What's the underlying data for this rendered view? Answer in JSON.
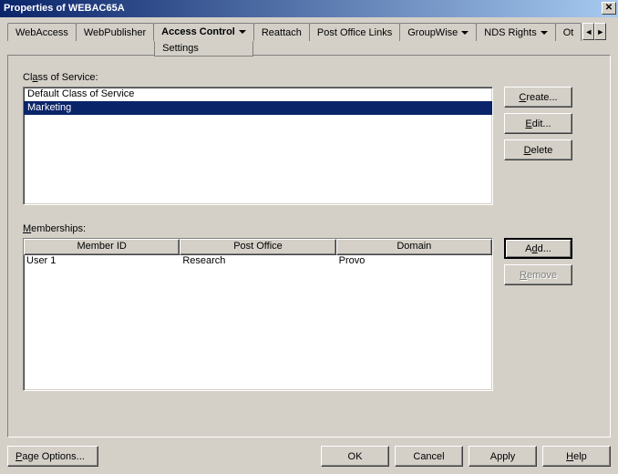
{
  "window": {
    "title": "Properties of WEBAC65A",
    "close_glyph": "✕"
  },
  "tabs": {
    "items": [
      "WebAccess",
      "WebPublisher",
      "Access Control",
      "Reattach",
      "Post Office Links",
      "GroupWise",
      "NDS Rights",
      "Ot"
    ],
    "dropdown_indices": [
      2,
      5,
      6
    ],
    "active_index": 2,
    "active_sub": "Settings",
    "nav_left": "◄",
    "nav_right": "►"
  },
  "class_of_service": {
    "label": "Class of Service:",
    "items": [
      "Default Class of Service",
      "Marketing"
    ],
    "selected_index": 1,
    "buttons": {
      "create": "Create...",
      "edit": "Edit...",
      "delete": "Delete"
    }
  },
  "memberships": {
    "label": "Memberships:",
    "columns": [
      "Member ID",
      "Post Office",
      "Domain"
    ],
    "rows": [
      {
        "member_id": "User 1",
        "post_office": "Research",
        "domain": "Provo"
      }
    ],
    "buttons": {
      "add": "Add...",
      "remove": "Remove"
    }
  },
  "footer": {
    "page_options": "Page Options...",
    "ok": "OK",
    "cancel": "Cancel",
    "apply": "Apply",
    "help": "Help"
  }
}
